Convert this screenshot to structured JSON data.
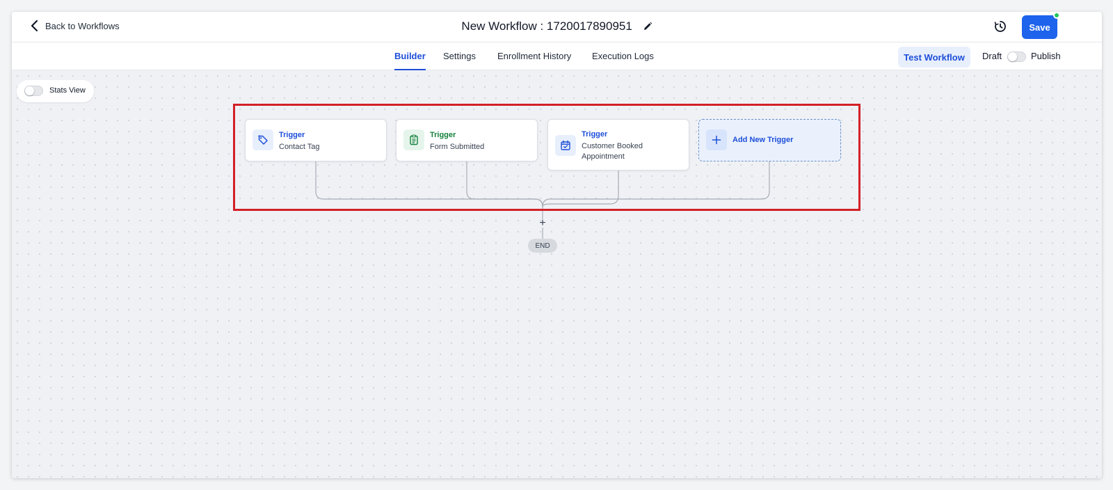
{
  "header": {
    "back_label": "Back to Workflows",
    "title": "New Workflow : 1720017890951",
    "save_label": "Save"
  },
  "tabs": [
    {
      "label": "Builder",
      "active": true
    },
    {
      "label": "Settings",
      "active": false
    },
    {
      "label": "Enrollment History",
      "active": false
    },
    {
      "label": "Execution Logs",
      "active": false
    }
  ],
  "actions": {
    "test_label": "Test Workflow",
    "draft_label": "Draft",
    "publish_label": "Publish",
    "publish_toggle_on": false
  },
  "canvas": {
    "stats_label": "Stats View",
    "stats_toggle_on": false,
    "triggers": [
      {
        "kind": "Trigger",
        "name": "Contact Tag",
        "icon": "tag-icon",
        "color": "#1d4ed8",
        "icon_bg": "#e8effc"
      },
      {
        "kind": "Trigger",
        "name": "Form Submitted",
        "icon": "clipboard-icon",
        "color": "#15803d",
        "icon_bg": "#e6f5ec"
      },
      {
        "kind": "Trigger",
        "name": "Customer Booked Appointment",
        "icon": "calendar-check-icon",
        "color": "#1d4ed8",
        "icon_bg": "#e8effc"
      }
    ],
    "add_trigger_label": "Add New Trigger",
    "end_label": "END"
  },
  "colors": {
    "accent": "#1d63ec",
    "highlight": "#d32027",
    "online_dot": "#22c55e"
  }
}
